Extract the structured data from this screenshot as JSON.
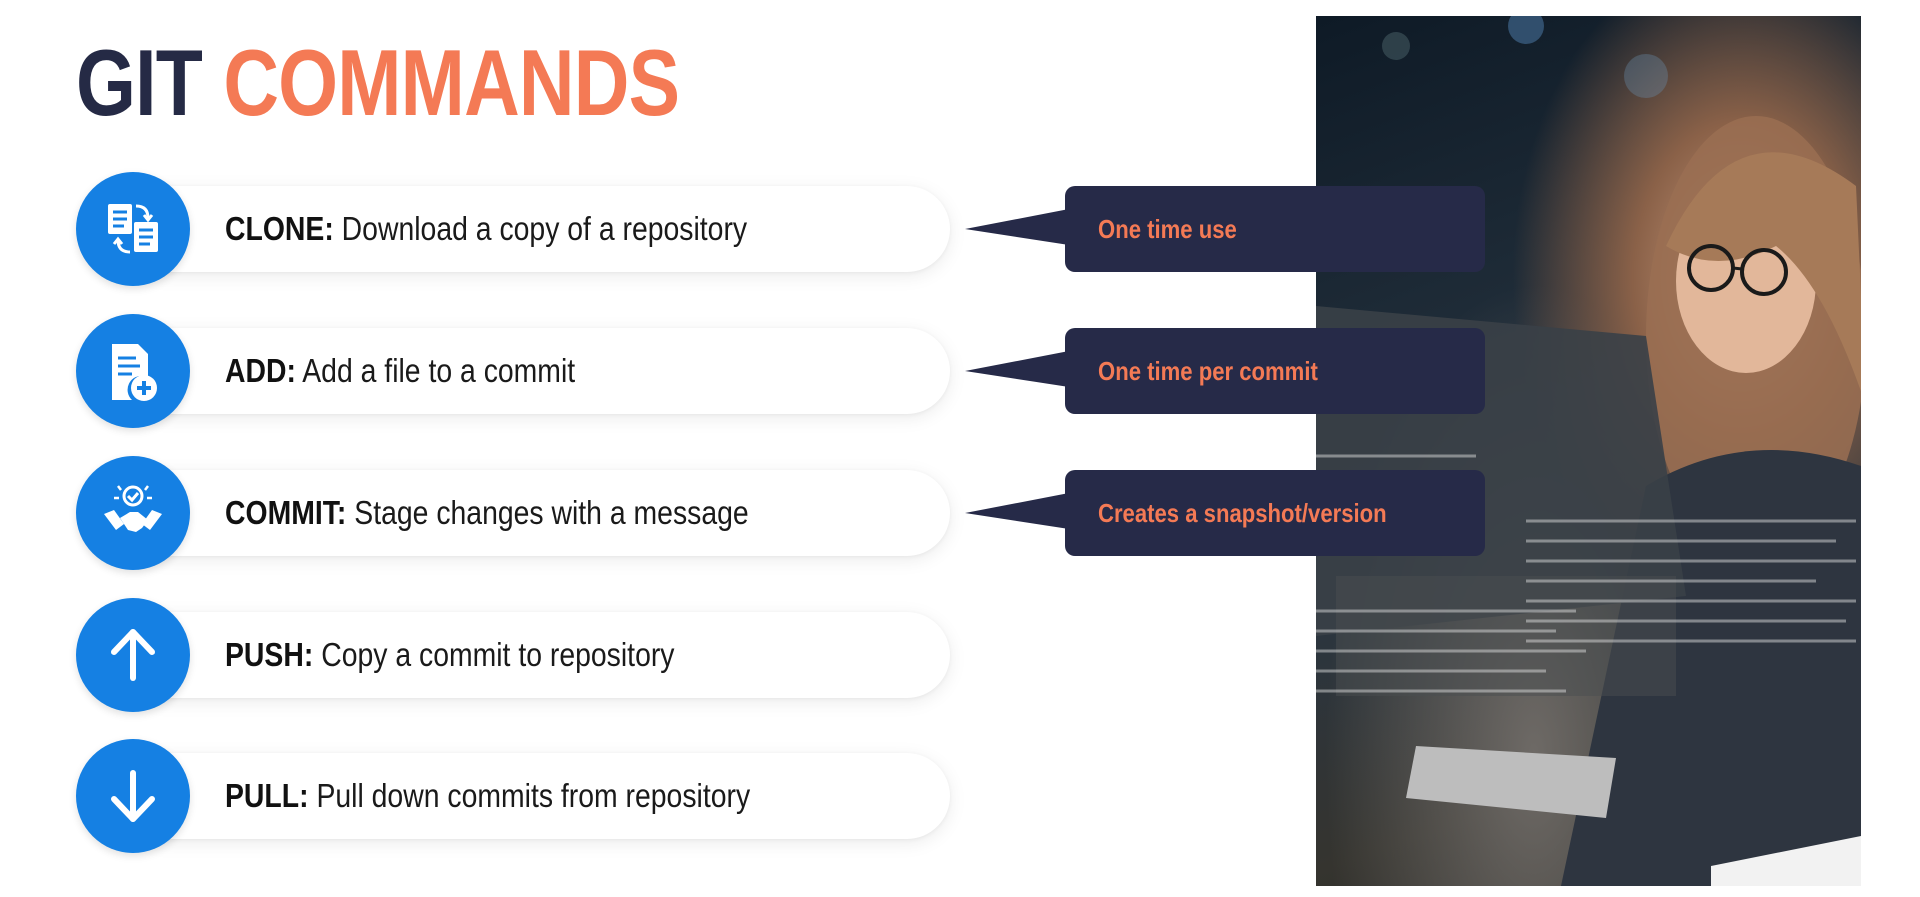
{
  "title": {
    "word1": "GIT",
    "word2": "COMMANDS"
  },
  "commands": [
    {
      "name": "CLONE:",
      "desc": " Download a copy of a repository",
      "icon": "clone-documents-icon"
    },
    {
      "name": "ADD:",
      "desc": " Add a file to a commit",
      "icon": "add-file-icon"
    },
    {
      "name": "COMMIT:",
      "desc": " Stage changes with a message",
      "icon": "handshake-check-icon"
    },
    {
      "name": "PUSH:",
      "desc": " Copy a commit to repository",
      "icon": "arrow-up-icon"
    },
    {
      "name": "PULL:",
      "desc": " Pull down commits from repository",
      "icon": "arrow-down-icon"
    }
  ],
  "callouts": [
    {
      "text": "One time use"
    },
    {
      "text": "One time per commit"
    },
    {
      "text": "Creates a snapshot/version"
    }
  ],
  "colors": {
    "title_dark": "#252a45",
    "accent": "#f47a55",
    "icon_blue": "#1580e3",
    "callout_bg": "#262a48"
  }
}
